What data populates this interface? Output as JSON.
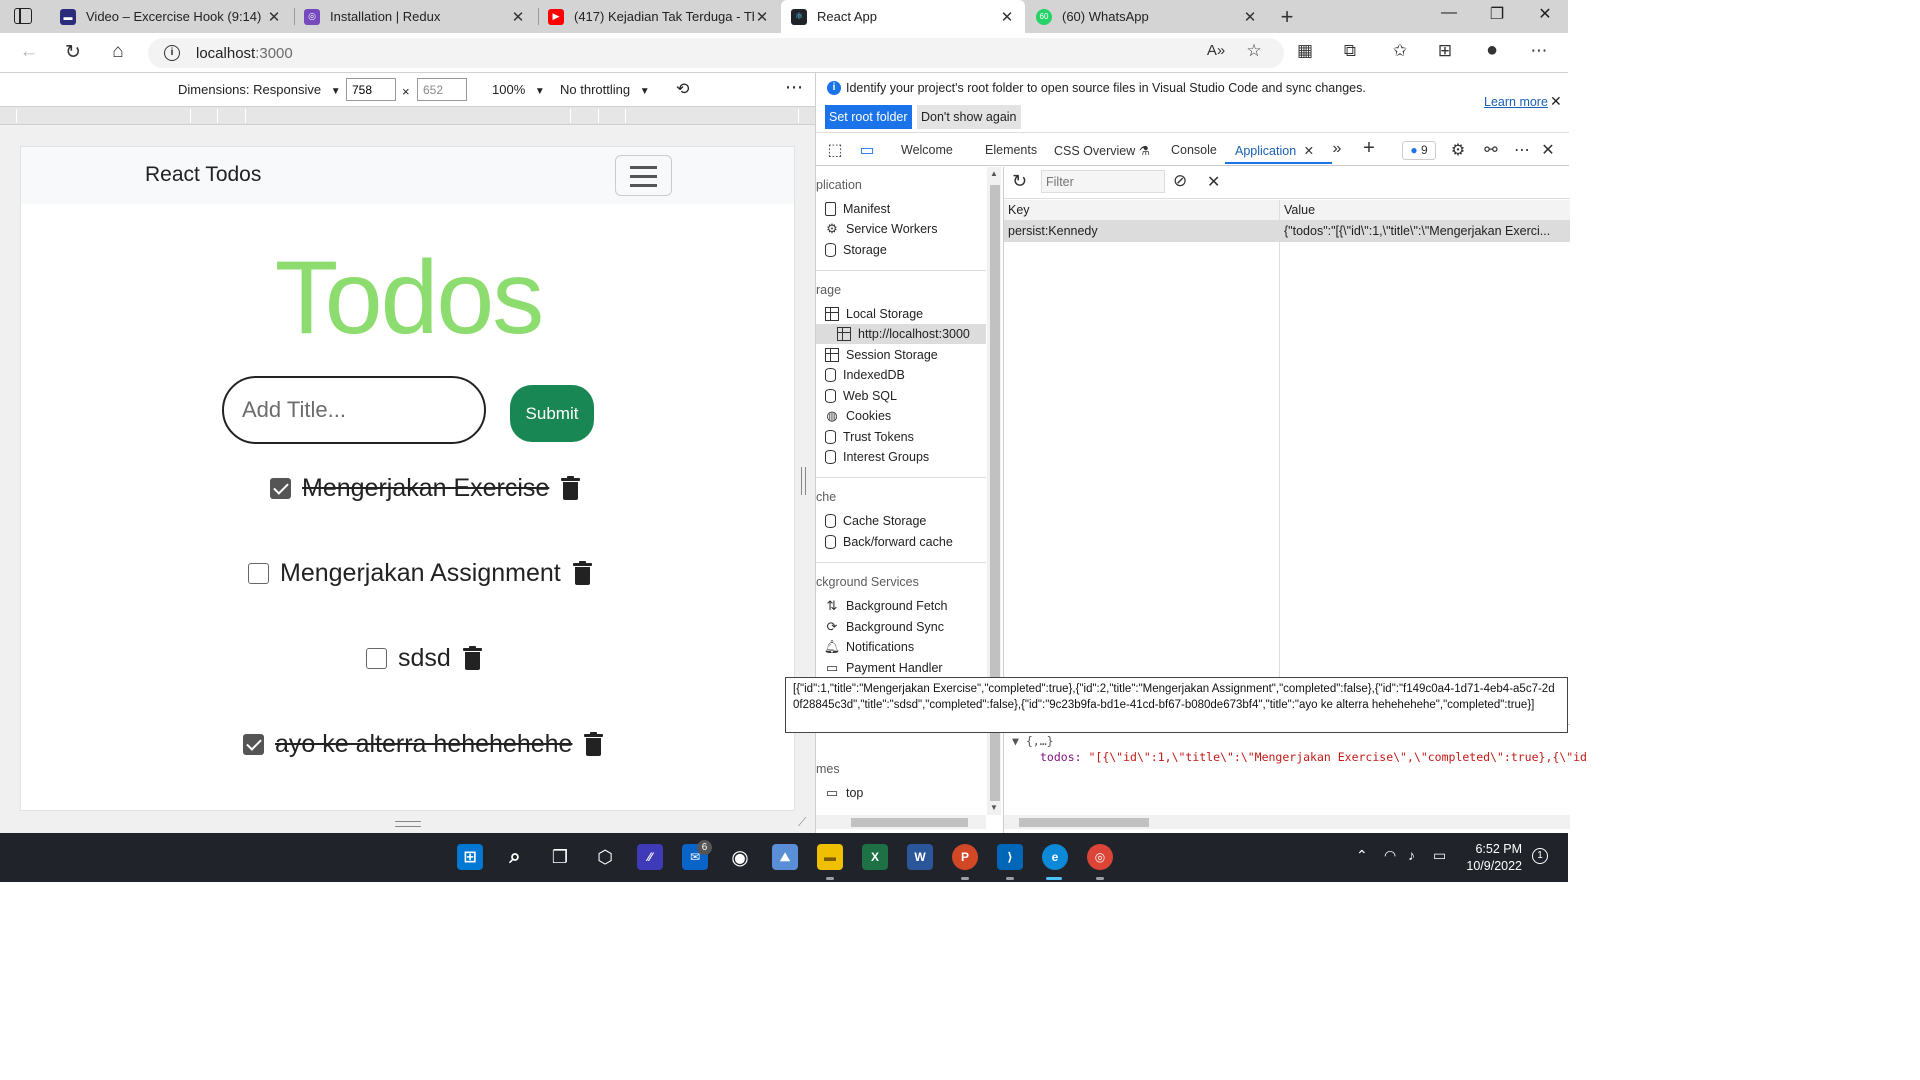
{
  "browser": {
    "tabs": [
      {
        "title": "Video – Excercise Hook (9:14)",
        "active": false
      },
      {
        "title": "Installation | Redux",
        "active": false
      },
      {
        "title": "(417) Kejadian Tak Terduga - The",
        "active": false
      },
      {
        "title": "React App",
        "active": true
      },
      {
        "title": "(60) WhatsApp",
        "active": false
      }
    ],
    "whatsapp_badge": "60",
    "url_host": "localhost",
    "url_port": ":3000"
  },
  "device_toolbar": {
    "dimensions_label": "Dimensions: Responsive",
    "width": "758",
    "height": "652",
    "zoom": "100%",
    "throttling": "No throttling"
  },
  "app": {
    "brand": "React Todos",
    "heading": "Todos",
    "input_placeholder": "Add Title...",
    "submit_label": "Submit",
    "todos": [
      {
        "title": "Mengerjakan Exercise",
        "completed": true
      },
      {
        "title": "Mengerjakan Assignment",
        "completed": false
      },
      {
        "title": "sdsd",
        "completed": false
      },
      {
        "title": "ayo ke alterra hehehehehe",
        "completed": true
      }
    ]
  },
  "devtools": {
    "infobar_message": "Identify your project's root folder to open source files in Visual Studio Code and sync changes.",
    "learn_more": "Learn more",
    "set_root_label": "Set root folder",
    "dont_show_label": "Don't show again",
    "tabs": [
      "Welcome",
      "Elements",
      "CSS Overview",
      "Console",
      "Application"
    ],
    "active_tab": "Application",
    "issues_count": "9",
    "sidebar": {
      "sections": [
        "plication",
        "rage",
        "che",
        "ckground Services",
        "mes"
      ],
      "application_items": [
        "Manifest",
        "Service Workers",
        "Storage"
      ],
      "storage_items": [
        "Local Storage",
        "http://localhost:3000",
        "Session Storage",
        "IndexedDB",
        "Web SQL",
        "Cookies",
        "Trust Tokens",
        "Interest Groups"
      ],
      "cache_items": [
        "Cache Storage",
        "Back/forward cache"
      ],
      "background_items": [
        "Background Fetch",
        "Background Sync",
        "Notifications",
        "Payment Handler"
      ],
      "frames_items": [
        "top"
      ]
    },
    "filter_placeholder": "Filter",
    "table": {
      "key_header": "Key",
      "value_header": "Value",
      "rows": [
        {
          "key": "persist:Kennedy",
          "value": "{\"todos\":\"[{\\\"id\\\":1,\\\"title\\\":\\\"Mengerjakan Exerci..."
        }
      ]
    },
    "json_preview": {
      "root": "{,…}",
      "key": "todos:",
      "value": "\"[{\\\"id\\\":1,\\\"title\\\":\\\"Mengerjakan Exercise\\\",\\\"completed\\\":true},{\\\"id"
    },
    "tooltip": "[{\"id\":1,\"title\":\"Mengerjakan Exercise\",\"completed\":true},{\"id\":2,\"title\":\"Mengerjakan Assignment\",\"completed\":false},{\"id\":\"f149c0a4-1d71-4eb4-a5c7-2d0f28845c3d\",\"title\":\"sdsd\",\"completed\":false},{\"id\":\"9c23b9fa-bd1e-41cd-bf67-b080de673bf4\",\"title\":\"ayo ke alterra hehehehehe\",\"completed\":true}]"
  },
  "taskbar": {
    "mail_badge": "6",
    "time": "6:52 PM",
    "date": "10/9/2022",
    "notification_count": "1"
  },
  "colors": {
    "todos_heading": "#8ddc6f",
    "submit_button": "#198754",
    "accent_blue": "#1a73e8"
  }
}
